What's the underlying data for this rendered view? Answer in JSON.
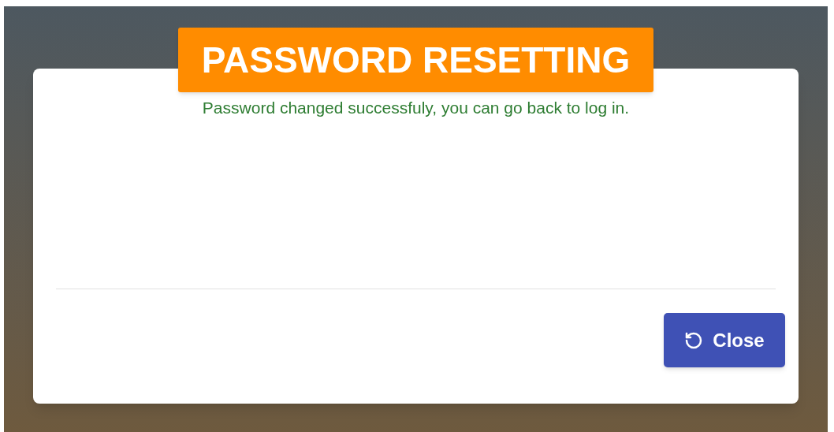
{
  "title": "PASSWORD RESETTING",
  "message": "Password changed successfuly, you can go back to log in.",
  "buttons": [
    {
      "label": "Close"
    }
  ]
}
